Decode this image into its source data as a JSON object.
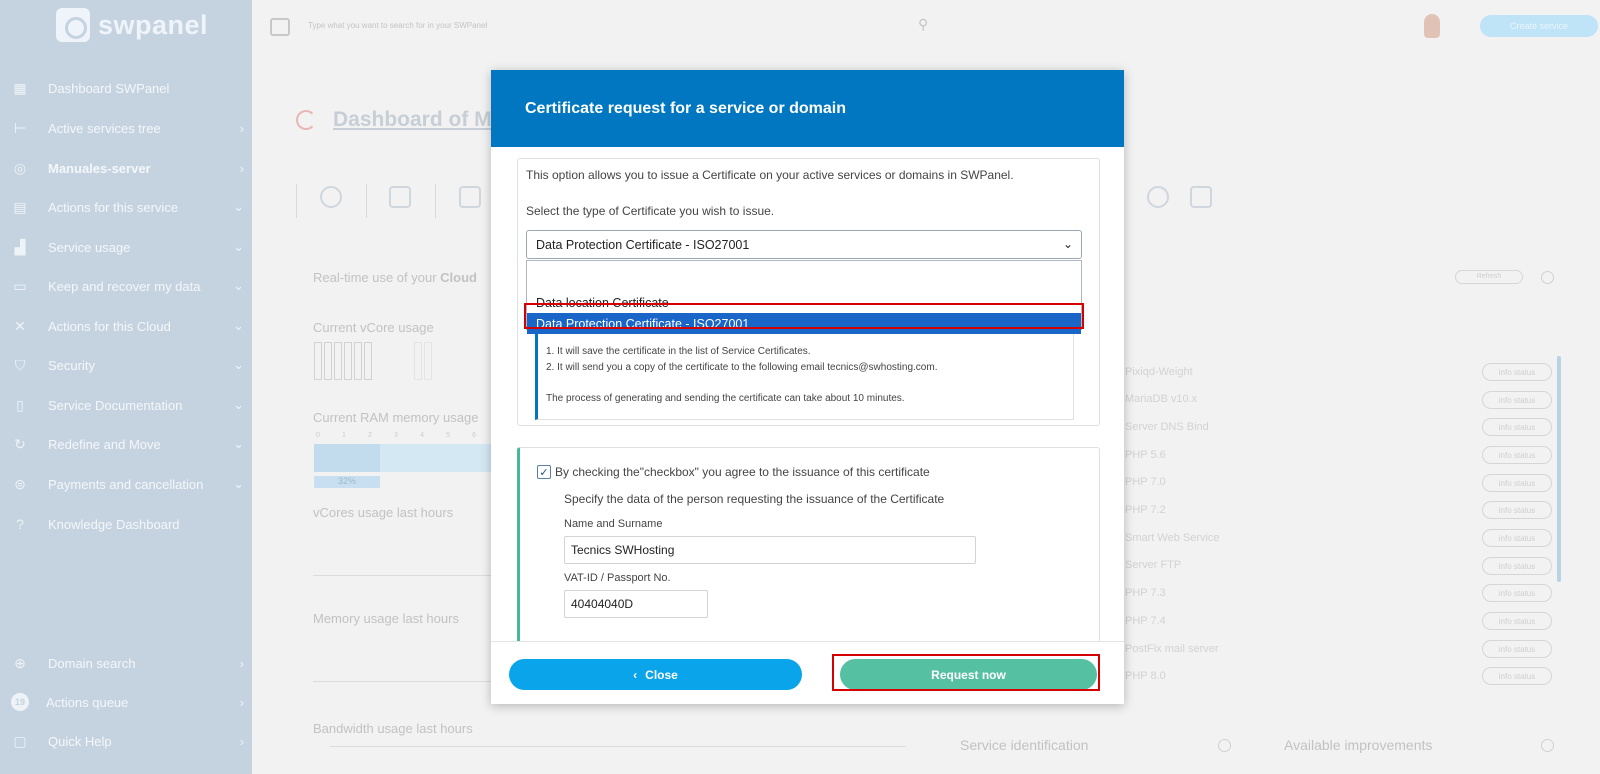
{
  "brand": {
    "name": "swpanel"
  },
  "sidebar": {
    "items": [
      {
        "label": "Dashboard SWPanel",
        "icon": "dashboard-icon",
        "chevron": ""
      },
      {
        "label": "Active services tree",
        "icon": "tree-icon",
        "chevron": "›"
      },
      {
        "label": "Manuales-server",
        "icon": "server-icon",
        "chevron": "›"
      },
      {
        "label": "Actions for this service",
        "icon": "actions-icon",
        "chevron": "⌄"
      },
      {
        "label": "Service usage",
        "icon": "chart-icon",
        "chevron": "⌄"
      },
      {
        "label": "Keep and recover my data",
        "icon": "archive-icon",
        "chevron": "⌄"
      },
      {
        "label": "Actions for this Cloud",
        "icon": "tools-icon",
        "chevron": "⌄"
      },
      {
        "label": "Security",
        "icon": "shield-icon",
        "chevron": "⌄"
      },
      {
        "label": "Service Documentation",
        "icon": "document-icon",
        "chevron": "⌄"
      },
      {
        "label": "Redefine and Move",
        "icon": "move-icon",
        "chevron": "⌄"
      },
      {
        "label": "Payments and cancellation",
        "icon": "payments-icon",
        "chevron": "⌄"
      },
      {
        "label": "Knowledge Dashboard",
        "icon": "help-icon",
        "chevron": ""
      }
    ],
    "bottom_items": [
      {
        "label": "Domain search",
        "icon": "globe-icon",
        "chevron": "›"
      },
      {
        "label": "Actions queue",
        "icon": "queue-icon",
        "badge": "19",
        "chevron": "›"
      },
      {
        "label": "Quick Help",
        "icon": "quick-help-icon",
        "chevron": "›"
      }
    ]
  },
  "topbar": {
    "search_placeholder": "Type what you want to search for in your SWPanel",
    "create_label": "Create service"
  },
  "page": {
    "title": "Dashboard of M",
    "realtime_label": "Real-time use of your ",
    "realtime_bold": "Cloud",
    "vcore_label": "Current vCore usage",
    "ram_label": "Current RAM memory usage",
    "ram_pct": "32%",
    "vcores_hours": "vCores usage last hours",
    "memory_hours": "Memory usage last hours",
    "bandwidth_hours": "Bandwidth usage last hours",
    "service_identification": "Service identification",
    "available_improvements": "Available improvements",
    "refresh_label": "Refresh",
    "ram_ticks": [
      "0",
      "1",
      "2",
      "3",
      "4",
      "5",
      "6"
    ],
    "services": [
      "Pixiqd-Weight",
      "MariaDB v10.x",
      "Server DNS Bind",
      "PHP 5.6",
      "PHP 7.0",
      "PHP 7.2",
      "Smart Web Service",
      "Server FTP",
      "PHP 7.3",
      "PHP 7.4",
      "PostFix mail server",
      "PHP 8.0"
    ],
    "info_status_label": "info status"
  },
  "modal": {
    "title": "Certificate request for a service or domain",
    "intro": "This option allows you to issue a Certificate on your active services or domains in SWPanel.",
    "select_label": "Select the type of Certificate you wish to issue.",
    "select_value": "Data Protection Certificate - ISO27001",
    "options": [
      "Data location Certificate",
      "Data Protection Certificate - ISO27001"
    ],
    "info_lines": [
      "1. It will save the certificate in the list of Service Certificates.",
      "2. It will send you a copy of the certificate to the following email ",
      "The process of generating and sending the certificate can take about 10 minutes."
    ],
    "email": "tecnics@swhosting.com",
    "agree_text": "By checking the\"checkbox\" you agree to the issuance of this certificate",
    "spec_text": "Specify the data of the person requesting the issuance of the Certificate",
    "name_label": "Name and Surname",
    "name_value": "Tecnics SWHosting",
    "vat_label": "VAT-ID / Passport No.",
    "vat_value": "40404040D",
    "close_label": "Close",
    "request_label": "Request now"
  },
  "colors": {
    "header_blue": "#0077c0",
    "close_button": "#09a4ea",
    "request_button": "#55c0a2",
    "highlight_red": "#d60000",
    "sidebar": "#c5d3e0"
  }
}
